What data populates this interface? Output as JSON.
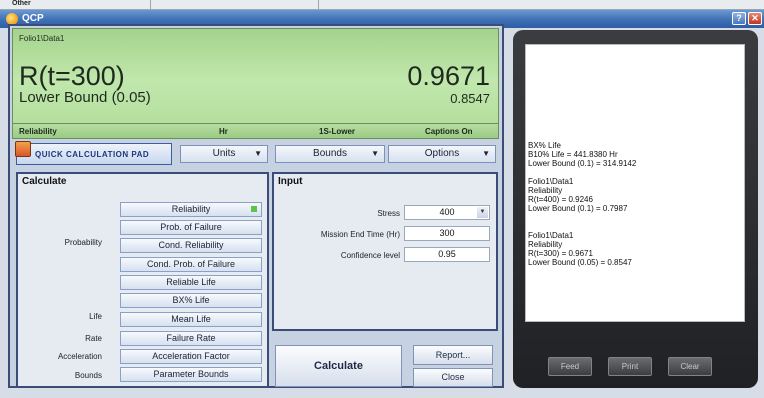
{
  "top_strip": {
    "label": "Other"
  },
  "window": {
    "title": "QCP",
    "help_glyph": "?",
    "close_glyph": "✕"
  },
  "display": {
    "folio": "Folio1\\Data1",
    "result_label": "R(t=300)",
    "result_value": "0.9671",
    "bound_label": "Lower Bound (0.05)",
    "bound_value": "0.8547"
  },
  "status_bar": {
    "metric": "Reliability",
    "units": "Hr",
    "bounds": "1S-Lower",
    "captions": "Captions On"
  },
  "toolbar": {
    "qcp_button": "QUICK CALCULATION PAD",
    "units": "Units",
    "bounds": "Bounds",
    "options": "Options"
  },
  "calculate": {
    "title": "Calculate",
    "categories": {
      "probability": "Probability",
      "life": "Life",
      "rate": "Rate",
      "acceleration": "Acceleration",
      "bounds": "Bounds"
    },
    "buttons": [
      "Reliability",
      "Prob. of Failure",
      "Cond. Reliability",
      "Cond. Prob. of Failure",
      "Reliable Life",
      "BX% Life",
      "Mean Life",
      "Failure Rate",
      "Acceleration Factor",
      "Parameter Bounds"
    ],
    "selected_index": 0
  },
  "input": {
    "title": "Input",
    "stress_label": "Stress",
    "stress_value": "400",
    "mission_label": "Mission End Time (Hr)",
    "mission_value": "300",
    "confidence_label": "Confidence level",
    "confidence_value": "0.95"
  },
  "actions": {
    "calculate": "Calculate",
    "report": "Report...",
    "close": "Close"
  },
  "printout": {
    "lines": [
      "BX% Life",
      "B10% Life = 441.8380 Hr",
      "Lower Bound (0.1) = 314.9142",
      "",
      "Folio1\\Data1",
      "Reliability",
      "R(t=400) = 0.9246",
      "Lower Bound (0.1) = 0.7987",
      "",
      "Folio1\\Data1",
      "Reliability",
      "R(t=300) = 0.9671",
      "Lower Bound (0.05) = 0.8547"
    ],
    "buttons": {
      "feed": "Feed",
      "print": "Print",
      "clear": "Clear"
    }
  },
  "colors": {
    "display_green": "#b5df9e",
    "title_bar_blue": "#3e6fb4",
    "panel_border": "#3b4c78",
    "printer_body": "#2b2c2f"
  }
}
